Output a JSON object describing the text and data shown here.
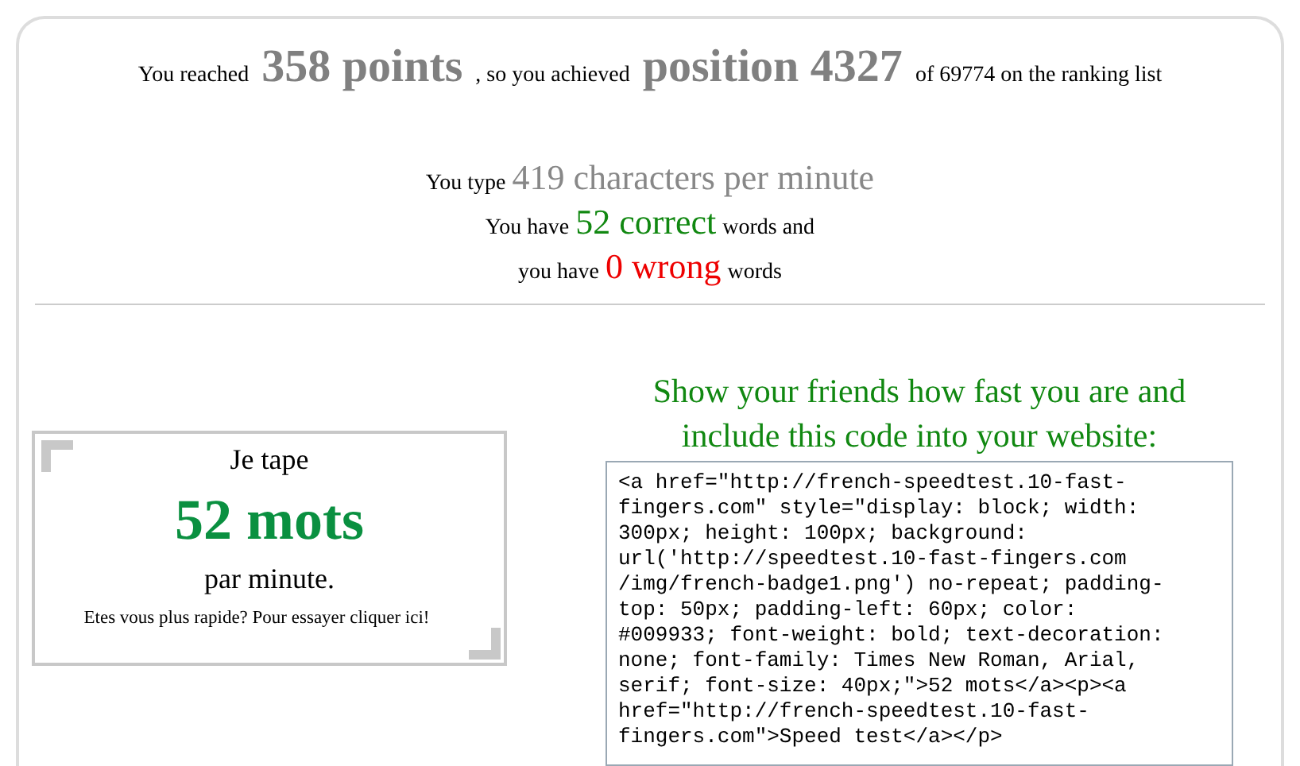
{
  "result": [
    {
      "kind": "plain",
      "text": "You reached"
    },
    {
      "kind": "highlight",
      "text": "358 points"
    },
    {
      "kind": "plain",
      "text": ", so you achieved"
    },
    {
      "kind": "highlight",
      "text": "position 4327"
    },
    {
      "kind": "plain",
      "text": "of 69774 on the ranking list"
    }
  ],
  "stats": [
    [
      {
        "kind": "plain",
        "text": "You type"
      },
      {
        "kind": "speed",
        "text": "419 characters per minute"
      }
    ],
    [
      {
        "kind": "plain",
        "text": "You have"
      },
      {
        "kind": "correct",
        "text": "52 correct"
      },
      {
        "kind": "plain",
        "text": "words and"
      }
    ],
    [
      {
        "kind": "plain",
        "text": "you have"
      },
      {
        "kind": "wrong",
        "text": "0 wrong"
      },
      {
        "kind": "plain",
        "text": "words"
      }
    ]
  ],
  "badge": {
    "intro": "Je tape",
    "count": "52 mots",
    "outro": "par minute.",
    "link": "Etes vous plus rapide? Pour essayer cliquer ici!"
  },
  "share": {
    "heading": "Show your friends how fast you are and include this code into your website:",
    "code": "<a href=\"http://french-speedtest.10-fast-fingers.com\" style=\"display: block; width: 300px; height: 100px; background: url('http://speedtest.10-fast-fingers.com /img/french-badge1.png') no-repeat; padding-top: 50px; padding-left: 60px; color: #009933; font-weight: bold; text-decoration: none; font-family: Times New Roman, Arial, serif; font-size: 40px;\">52 mots</a><p><a href=\"http://french-speedtest.10-fast-fingers.com\">Speed test</a></p>"
  }
}
